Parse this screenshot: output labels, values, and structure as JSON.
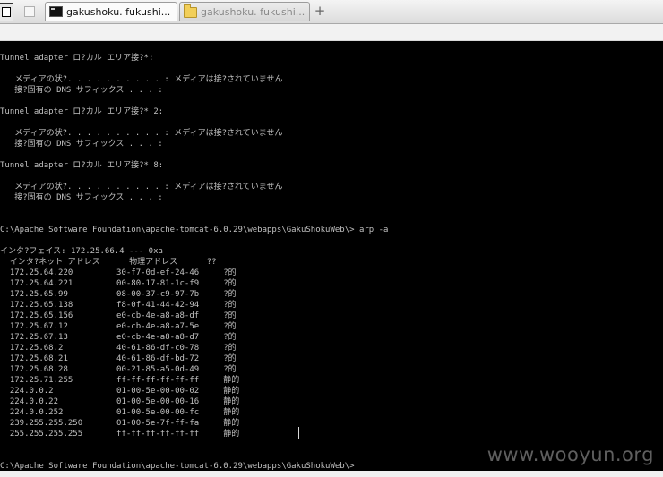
{
  "tabs": [
    {
      "title": "gakushoku. fukushi...",
      "icon": "cmd-icon",
      "active": true
    },
    {
      "title": "gakushoku. fukushi...",
      "icon": "folder-icon",
      "active": false
    }
  ],
  "new_tab_label": "+",
  "console_lines": [
    "Tunnel adapter ロ?カル エリア接?*:",
    "",
    "   メディアの状?. . . . . . . . . . : メディアは接?されていません",
    "   接?固有の DNS サフィックス . . . :",
    "",
    "Tunnel adapter ロ?カル エリア接?* 2:",
    "",
    "   メディアの状?. . . . . . . . . . : メディアは接?されていません",
    "   接?固有の DNS サフィックス . . . :",
    "",
    "Tunnel adapter ロ?カル エリア接?* 8:",
    "",
    "   メディアの状?. . . . . . . . . . : メディアは接?されていません",
    "   接?固有の DNS サフィックス . . . :",
    "",
    "",
    "C:\\Apache Software Foundation\\apache-tomcat-6.0.29\\webapps\\GakuShokuWeb\\> arp -a",
    "",
    "インタ?フェイス: 172.25.66.4 --- 0xa",
    "  インタ?ネット アドレス      物理アドレス      ??",
    "  172.25.64.220         30-f7-0d-ef-24-46     ?的",
    "  172.25.64.221         00-80-17-81-1c-f9     ?的",
    "  172.25.65.99          08-00-37-c9-97-7b     ?的",
    "  172.25.65.138         f8-0f-41-44-42-94     ?的",
    "  172.25.65.156         e0-cb-4e-a8-a8-df     ?的",
    "  172.25.67.12          e0-cb-4e-a8-a7-5e     ?的",
    "  172.25.67.13          e0-cb-4e-a8-a8-d7     ?的",
    "  172.25.68.2           40-61-86-df-c0-78     ?的",
    "  172.25.68.21          40-61-86-df-bd-72     ?的",
    "  172.25.68.28          00-21-85-a5-0d-49     ?的",
    "  172.25.71.255         ff-ff-ff-ff-ff-ff     静的",
    "  224.0.0.2             01-00-5e-00-00-02     静的",
    "  224.0.0.22            01-00-5e-00-00-16     静的",
    "  224.0.0.252           01-00-5e-00-00-fc     静的",
    "  239.255.255.250       01-00-5e-7f-ff-fa     静的",
    "  255.255.255.255       ff-ff-ff-ff-ff-ff     静的",
    "",
    "",
    "C:\\Apache Software Foundation\\apache-tomcat-6.0.29\\webapps\\GakuShokuWeb\\>"
  ],
  "watermark": "www.wooyun.org",
  "colors": {
    "console_bg": "#000000",
    "console_text": "#c0c0c0"
  }
}
